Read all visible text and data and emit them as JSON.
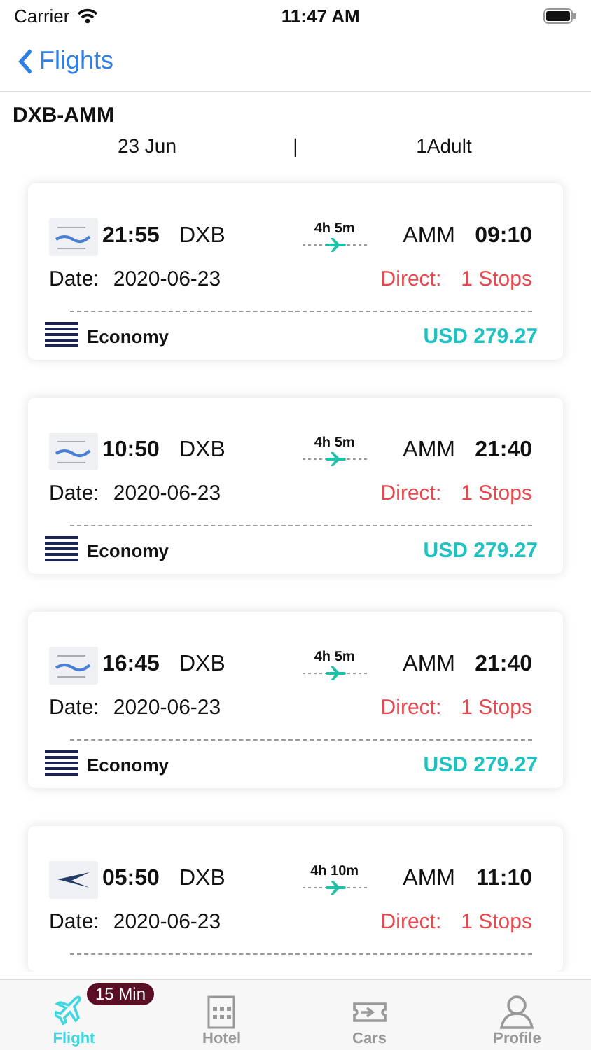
{
  "status_bar": {
    "carrier": "Carrier",
    "time": "11:47 AM"
  },
  "nav": {
    "back_label": "Flights"
  },
  "search": {
    "route": "DXB-AMM",
    "date": "23 Jun",
    "separator": "|",
    "passengers": "1Adult"
  },
  "flights": [
    {
      "kind": "wave",
      "depart_time": "21:55",
      "from": "DXB",
      "duration": "4h 5m",
      "to": "AMM",
      "arrive_time": "09:10",
      "date_label": "Date:",
      "date": "2020-06-23",
      "direct_label": "Direct:",
      "stops": "1  Stops",
      "cabin": "Economy",
      "price": "USD 279.27"
    },
    {
      "kind": "wave",
      "depart_time": "10:50",
      "from": "DXB",
      "duration": "4h 5m",
      "to": "AMM",
      "arrive_time": "21:40",
      "date_label": "Date:",
      "date": "2020-06-23",
      "direct_label": "Direct:",
      "stops": "1  Stops",
      "cabin": "Economy",
      "price": "USD 279.27"
    },
    {
      "kind": "wave",
      "depart_time": "16:45",
      "from": "DXB",
      "duration": "4h 5m",
      "to": "AMM",
      "arrive_time": "21:40",
      "date_label": "Date:",
      "date": "2020-06-23",
      "direct_label": "Direct:",
      "stops": "1  Stops",
      "cabin": "Economy",
      "price": "USD 279.27"
    },
    {
      "kind": "bird",
      "depart_time": "05:50",
      "from": "DXB",
      "duration": "4h 10m",
      "to": "AMM",
      "arrive_time": "11:10",
      "date_label": "Date:",
      "date": "2020-06-23",
      "direct_label": "Direct:",
      "stops": "1  Stops"
    }
  ],
  "tabs": [
    {
      "kind": "flight",
      "label": "Flight",
      "selected": true,
      "badge": "15 Min"
    },
    {
      "kind": "hotel",
      "label": "Hotel",
      "selected": false
    },
    {
      "kind": "cars",
      "label": "Cars",
      "selected": false
    },
    {
      "kind": "profile",
      "label": "Profile",
      "selected": false
    }
  ]
}
